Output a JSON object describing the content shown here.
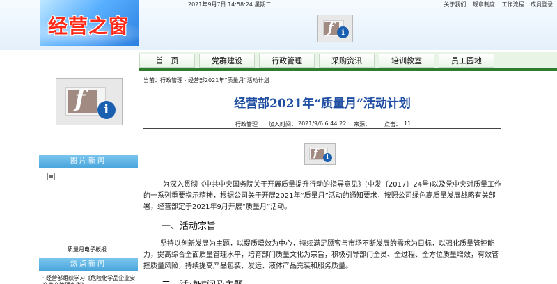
{
  "header": {
    "logo_text": "经营之窗",
    "datetime": "2021年9月7日 14:58:24 星期二",
    "top_links": [
      "关于我们",
      "规章制度",
      "工作流程",
      "成员登录"
    ]
  },
  "nav": {
    "tabs": [
      "首　页",
      "党群建设",
      "行政管理",
      "采购资讯",
      "培训教室",
      "员工园地"
    ]
  },
  "sidebar": {
    "pic_news_title": "图片新闻",
    "pic_caption": "质量月电子板报",
    "hot_news_title": "热点新闻",
    "hot_item": "经营部组织学习《危险化学品企业安全生产管理条例》"
  },
  "article": {
    "breadcrumb": "当前：行政管理 - 经营部2021年“质量月”活动计划",
    "title": "经营部2021年“质量月”活动计划",
    "meta": {
      "category": "行政管理",
      "date_label": "加入时间：",
      "date_value": "2021/9/6 6:44:22",
      "source_label": "来源：",
      "source_value": "",
      "clicks_label": "点击：",
      "clicks_value": "11"
    },
    "para1": "为深入贯彻《中共中央国务院关于开展质量提升行动的指导意见》(中发〔2017〕24号)以及党中央对质量工作的一系列重要指示精神，根据公司关于开展2021年“质量月”活动的通知要求，按照公司绿色高质量发展战略有关部署，经营部定于2021年9月开展“质量月”活动。",
    "heading1": "一、活动宗旨",
    "para2": "坚持以创新发展为主题，以提质增效为中心，持续满足顾客与市场不断发展的需求为目标，以强化质量管控能力，提高综合全面质量管理水平，培育部门质量文化为宗旨，积极引导部门全员、全过程、全方位质量增效，有效管控质量风险，持续提高产品包装、发运、液体产品充装和服务质量。",
    "heading2": "二、活动时间及主题"
  }
}
